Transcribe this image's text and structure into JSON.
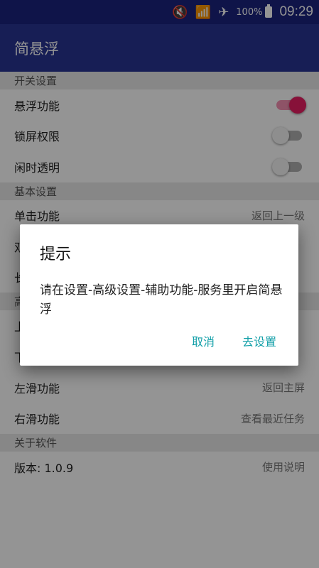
{
  "status_bar": {
    "icons": [
      "mute-icon",
      "wifi-icon",
      "airplane-icon"
    ],
    "battery_percent": "100%",
    "time": "09:29"
  },
  "app_bar": {
    "title": "简悬浮"
  },
  "sections": {
    "switch": {
      "header": "开关设置",
      "items": [
        {
          "label": "悬浮功能",
          "checked": true
        },
        {
          "label": "锁屏权限",
          "checked": false
        },
        {
          "label": "闲时透明",
          "checked": false
        }
      ]
    },
    "basic": {
      "header": "基本设置",
      "items": [
        {
          "label": "单击功能",
          "value": "返回上一级"
        },
        {
          "label": "双",
          "value": ""
        },
        {
          "label": "长",
          "value": ""
        }
      ]
    },
    "advanced": {
      "header": "高",
      "items": [
        {
          "label": "上",
          "value": ""
        },
        {
          "label": "下",
          "value": ""
        },
        {
          "label": "左滑功能",
          "value": "返回主屏"
        },
        {
          "label": "右滑功能",
          "value": "查看最近任务"
        }
      ]
    },
    "about": {
      "header": "关于软件",
      "items": [
        {
          "label": "版本: 1.0.9",
          "value": "使用说明"
        }
      ]
    }
  },
  "dialog": {
    "title": "提示",
    "message": "请在设置-高级设置-辅助功能-服务里开启简悬浮",
    "cancel_label": "取消",
    "confirm_label": "去设置"
  },
  "colors": {
    "status_bar": "#1a237e",
    "app_bar": "#283593",
    "switch_on": "#e91e63",
    "dialog_button": "#0f9ea7"
  }
}
